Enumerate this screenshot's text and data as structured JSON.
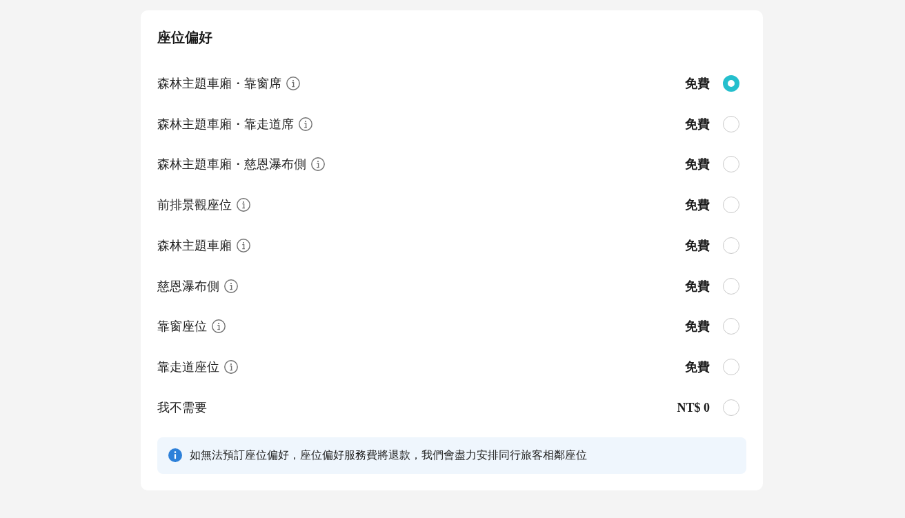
{
  "seat_preference": {
    "title": "座位偏好",
    "options": [
      {
        "label": "森林主題車廂・靠窗席",
        "info_icon": true,
        "price": "免費",
        "selected": true
      },
      {
        "label": "森林主題車廂・靠走道席",
        "info_icon": true,
        "price": "免費",
        "selected": false
      },
      {
        "label": "森林主題車廂・慈恩瀑布側",
        "info_icon": true,
        "price": "免費",
        "selected": false
      },
      {
        "label": "前排景觀座位",
        "info_icon": true,
        "price": "免費",
        "selected": false
      },
      {
        "label": "森林主題車廂",
        "info_icon": true,
        "price": "免費",
        "selected": false
      },
      {
        "label": "慈恩瀑布側",
        "info_icon": true,
        "price": "免費",
        "selected": false
      },
      {
        "label": "靠窗座位",
        "info_icon": true,
        "price": "免費",
        "selected": false
      },
      {
        "label": "靠走道座位",
        "info_icon": true,
        "price": "免費",
        "selected": false
      },
      {
        "label": "我不需要",
        "info_icon": false,
        "price": "NT$ 0",
        "selected": false
      }
    ],
    "notice": "如無法預訂座位偏好，座位偏好服務費將退款，我們會盡力安排同行旅客相鄰座位"
  }
}
